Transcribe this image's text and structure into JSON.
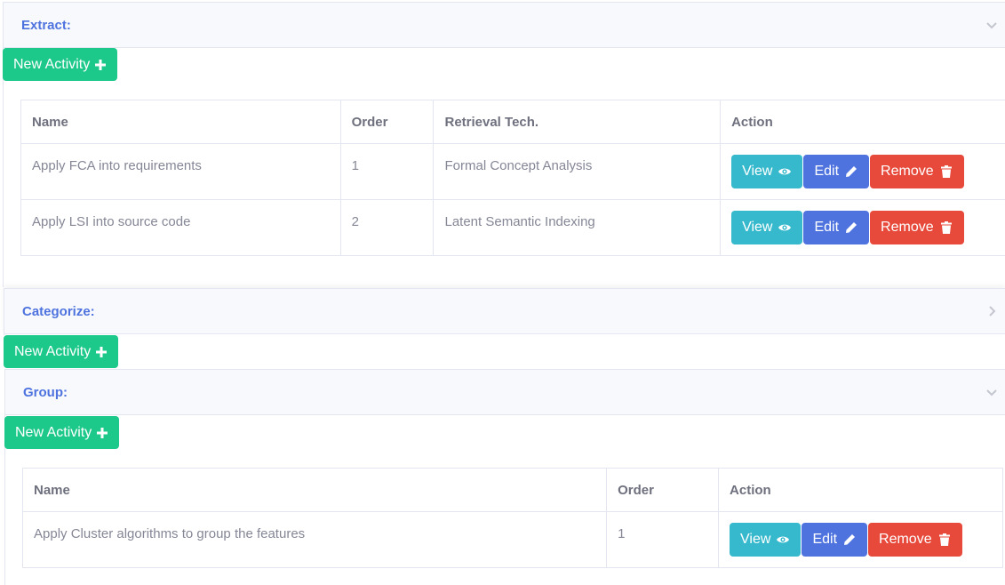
{
  "sections": {
    "extract": {
      "title": "Extract:",
      "new_label": "New Activity",
      "columns": [
        "Name",
        "Order",
        "Retrieval Tech.",
        "Action"
      ],
      "rows": [
        {
          "name": "Apply FCA into requirements",
          "order": "1",
          "tech": "Formal Concept Analysis"
        },
        {
          "name": "Apply LSI into source code",
          "order": "2",
          "tech": "Latent Semantic Indexing"
        }
      ]
    },
    "categorize": {
      "title": "Categorize:",
      "new_label": "New Activity"
    },
    "group": {
      "title": "Group:",
      "new_label": "New Activity",
      "columns": [
        "Name",
        "Order",
        "Action"
      ],
      "rows": [
        {
          "name": "Apply Cluster algorithms to group the features",
          "order": "1"
        }
      ]
    }
  },
  "actions": {
    "view": "View",
    "edit": "Edit",
    "remove": "Remove"
  },
  "icons": {
    "collapse": "chevron-down-icon",
    "expand": "chevron-right-icon",
    "add": "plus-icon",
    "view": "eye-icon",
    "edit": "pencil-icon",
    "remove": "trash-icon"
  },
  "colors": {
    "primary": "#4e73df",
    "success": "#1cc88a",
    "info": "#36b9cc",
    "danger": "#e74a3b"
  }
}
